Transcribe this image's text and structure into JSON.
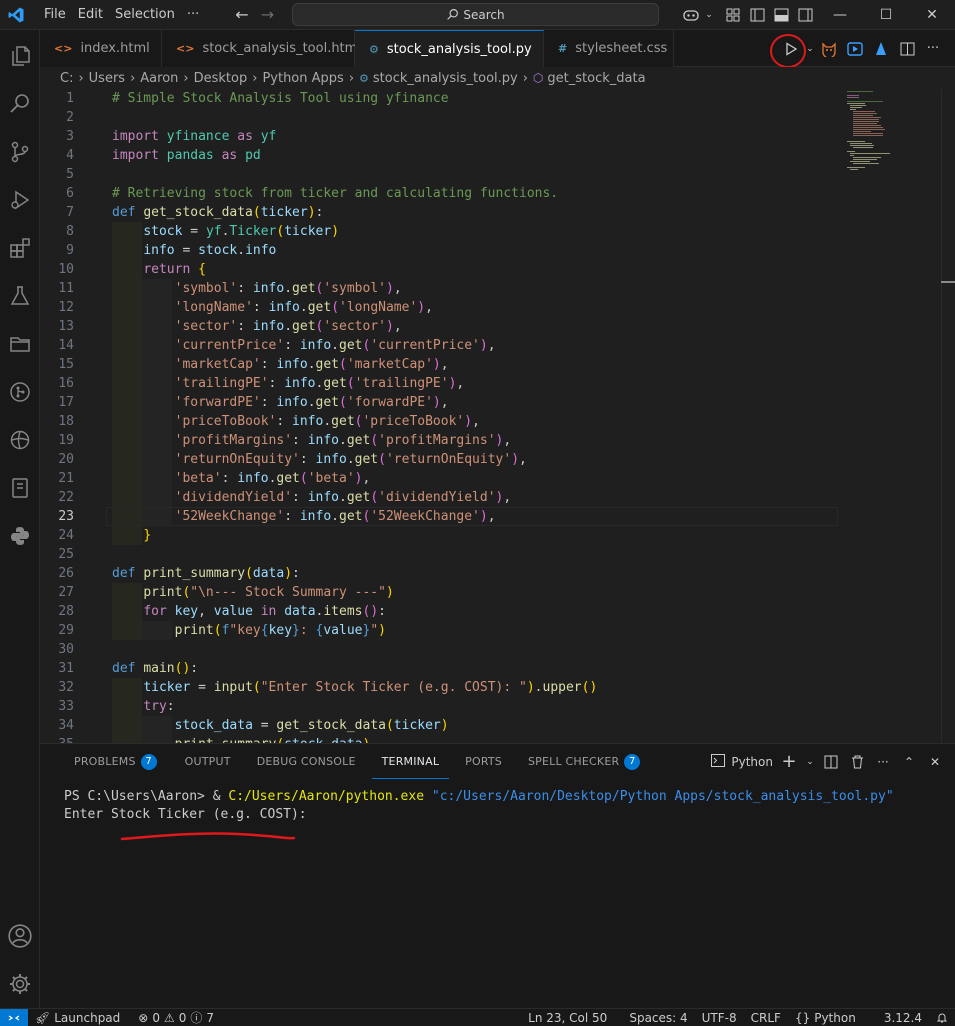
{
  "titlebar": {
    "menu": [
      "File",
      "Edit",
      "Selection",
      "···"
    ],
    "search_label": "Search"
  },
  "tabs": [
    {
      "label": "index.html",
      "icon": "html-icon",
      "color": "#e37933",
      "active": false
    },
    {
      "label": "stock_analysis_tool.html",
      "icon": "html-icon",
      "color": "#e37933",
      "active": false
    },
    {
      "label": "stock_analysis_tool.py",
      "icon": "python-icon",
      "color": "#519aba",
      "active": true
    },
    {
      "label": "stylesheet.css",
      "icon": "css-icon",
      "color": "#519aba",
      "active": false
    }
  ],
  "breadcrumb": [
    "C:",
    "Users",
    "Aaron",
    "Desktop",
    "Python Apps",
    "stock_analysis_tool.py",
    "get_stock_data"
  ],
  "editor": {
    "current_line": 23,
    "lines": [
      {
        "n": "1",
        "html": "<span class=\"c\"># Simple Stock Analysis Tool using yfinance</span>"
      },
      {
        "n": "2",
        "html": ""
      },
      {
        "n": "3",
        "html": "<span class=\"k\">import</span> <span class=\"cl\">yfinance</span> <span class=\"k\">as</span> <span class=\"cl\">yf</span>"
      },
      {
        "n": "4",
        "html": "<span class=\"k\">import</span> <span class=\"cl\">pandas</span> <span class=\"k\">as</span> <span class=\"cl\">pd</span>"
      },
      {
        "n": "5",
        "html": ""
      },
      {
        "n": "6",
        "html": "<span class=\"c\"># Retrieving stock from ticker and calculating functions.</span>"
      },
      {
        "n": "7",
        "html": "<span class=\"kd\">def</span> <span class=\"f\">get_stock_data</span><span class=\"br\">(</span><span class=\"v\">ticker</span><span class=\"br\">)</span>:"
      },
      {
        "n": "8",
        "html": "    <span class=\"v\">stock</span> = <span class=\"cl\">yf</span>.<span class=\"cl\">Ticker</span><span class=\"br\">(</span><span class=\"v\">ticker</span><span class=\"br\">)</span>"
      },
      {
        "n": "9",
        "html": "    <span class=\"v\">info</span> = <span class=\"v\">stock</span>.<span class=\"v\">info</span>"
      },
      {
        "n": "10",
        "html": "    <span class=\"k\">return</span> <span class=\"br\">{</span>"
      },
      {
        "n": "11",
        "html": "        <span class=\"s\">'symbol'</span>: <span class=\"v\">info</span>.<span class=\"f\">get</span><span class=\"br2\">(</span><span class=\"s\">'symbol'</span><span class=\"br2\">)</span>,"
      },
      {
        "n": "12",
        "html": "        <span class=\"s\">'longName'</span>: <span class=\"v\">info</span>.<span class=\"f\">get</span><span class=\"br2\">(</span><span class=\"s\">'longName'</span><span class=\"br2\">)</span>,"
      },
      {
        "n": "13",
        "html": "        <span class=\"s\">'sector'</span>: <span class=\"v\">info</span>.<span class=\"f\">get</span><span class=\"br2\">(</span><span class=\"s\">'sector'</span><span class=\"br2\">)</span>,"
      },
      {
        "n": "14",
        "html": "        <span class=\"s\">'currentPrice'</span>: <span class=\"v\">info</span>.<span class=\"f\">get</span><span class=\"br2\">(</span><span class=\"s\">'currentPrice'</span><span class=\"br2\">)</span>,"
      },
      {
        "n": "15",
        "html": "        <span class=\"s\">'marketCap'</span>: <span class=\"v\">info</span>.<span class=\"f\">get</span><span class=\"br2\">(</span><span class=\"s\">'marketCap'</span><span class=\"br2\">)</span>,"
      },
      {
        "n": "16",
        "html": "        <span class=\"s\">'trailingPE'</span>: <span class=\"v\">info</span>.<span class=\"f\">get</span><span class=\"br2\">(</span><span class=\"s\">'trailingPE'</span><span class=\"br2\">)</span>,"
      },
      {
        "n": "17",
        "html": "        <span class=\"s\">'forwardPE'</span>: <span class=\"v\">info</span>.<span class=\"f\">get</span><span class=\"br2\">(</span><span class=\"s\">'forwardPE'</span><span class=\"br2\">)</span>,"
      },
      {
        "n": "18",
        "html": "        <span class=\"s\">'priceToBook'</span>: <span class=\"v\">info</span>.<span class=\"f\">get</span><span class=\"br2\">(</span><span class=\"s\">'priceToBook'</span><span class=\"br2\">)</span>,"
      },
      {
        "n": "19",
        "html": "        <span class=\"s\">'profitMargins'</span>: <span class=\"v\">info</span>.<span class=\"f\">get</span><span class=\"br2\">(</span><span class=\"s\">'profitMargins'</span><span class=\"br2\">)</span>,"
      },
      {
        "n": "20",
        "html": "        <span class=\"s\">'returnOnEquity'</span>: <span class=\"v\">info</span>.<span class=\"f\">get</span><span class=\"br2\">(</span><span class=\"s\">'returnOnEquity'</span><span class=\"br2\">)</span>,"
      },
      {
        "n": "21",
        "html": "        <span class=\"s\">'beta'</span>: <span class=\"v\">info</span>.<span class=\"f\">get</span><span class=\"br2\">(</span><span class=\"s\">'beta'</span><span class=\"br2\">)</span>,"
      },
      {
        "n": "22",
        "html": "        <span class=\"s\">'dividendYield'</span>: <span class=\"v\">info</span>.<span class=\"f\">get</span><span class=\"br2\">(</span><span class=\"s\">'dividendYield'</span><span class=\"br2\">)</span>,"
      },
      {
        "n": "23",
        "html": "        <span class=\"s\">'52WeekChange'</span>: <span class=\"v\">info</span>.<span class=\"f\">get</span><span class=\"br2\">(</span><span class=\"s\">'52WeekChange'</span><span class=\"br2\">)</span>,"
      },
      {
        "n": "24",
        "html": "    <span class=\"br\">}</span>"
      },
      {
        "n": "25",
        "html": ""
      },
      {
        "n": "26",
        "html": "<span class=\"kd\">def</span> <span class=\"f\">print_summary</span><span class=\"br\">(</span><span class=\"v\">data</span><span class=\"br\">)</span>:"
      },
      {
        "n": "27",
        "html": "    <span class=\"f\">print</span><span class=\"br\">(</span><span class=\"s\">\"\\n--- Stock Summary ---\"</span><span class=\"br\">)</span>"
      },
      {
        "n": "28",
        "html": "    <span class=\"k\">for</span> <span class=\"v\">key</span>, <span class=\"v\">value</span> <span class=\"k\">in</span> <span class=\"v\">data</span>.<span class=\"f\">items</span><span class=\"br2\">()</span>:"
      },
      {
        "n": "29",
        "html": "        <span class=\"f\">print</span><span class=\"br\">(</span><span class=\"kd\">f</span><span class=\"s\">\"key</span><span class=\"kd\">{</span><span class=\"v\">key</span><span class=\"kd\">}</span><span class=\"s\">: </span><span class=\"kd\">{</span><span class=\"v\">value</span><span class=\"kd\">}</span><span class=\"s\">\"</span><span class=\"br\">)</span>"
      },
      {
        "n": "30",
        "html": ""
      },
      {
        "n": "31",
        "html": "<span class=\"kd\">def</span> <span class=\"f\">main</span><span class=\"br\">()</span>:"
      },
      {
        "n": "32",
        "html": "    <span class=\"v\">ticker</span> = <span class=\"f\">input</span><span class=\"br\">(</span><span class=\"s\">\"Enter Stock Ticker (e.g. COST): \"</span><span class=\"br\">)</span>.<span class=\"f\">upper</span><span class=\"br\">()</span>"
      },
      {
        "n": "33",
        "html": "    <span class=\"k\">try</span>:"
      },
      {
        "n": "34",
        "html": "        <span class=\"v\">stock_data</span> = <span class=\"f\">get_stock_data</span><span class=\"br\">(</span><span class=\"v\">ticker</span><span class=\"br\">)</span>"
      },
      {
        "n": "35",
        "html": "        <span class=\"f\">print_summary</span><span class=\"br\">(</span><span class=\"v\">stock_data</span><span class=\"br\">)</span>"
      }
    ]
  },
  "panel": {
    "tabs": [
      {
        "label": "PROBLEMS",
        "badge": "7"
      },
      {
        "label": "OUTPUT",
        "badge": ""
      },
      {
        "label": "DEBUG CONSOLE",
        "badge": ""
      },
      {
        "label": "TERMINAL",
        "badge": "",
        "active": true
      },
      {
        "label": "PORTS",
        "badge": ""
      },
      {
        "label": "SPELL CHECKER",
        "badge": "7"
      }
    ],
    "terminal_name": "Python",
    "terminal": {
      "prompt": "PS C:\\Users\\Aaron> ",
      "amp": "& ",
      "exe": "C:/Users/Aaron/python.exe",
      "arg": "\"c:/Users/Aaron/Desktop/Python Apps/stock_analysis_tool.py\"",
      "line2": "Enter Stock Ticker (e.g. COST):"
    }
  },
  "statusbar": {
    "launchpad": "Launchpad",
    "errors": "0",
    "warnings": "0",
    "info": "7",
    "position": "Ln 23, Col 50",
    "spaces": "Spaces: 4",
    "encoding": "UTF-8",
    "eol": "CRLF",
    "language": "Python",
    "version": "3.12.4"
  },
  "colors": {
    "accent": "#0078d4",
    "annotation": "#e0191c"
  }
}
